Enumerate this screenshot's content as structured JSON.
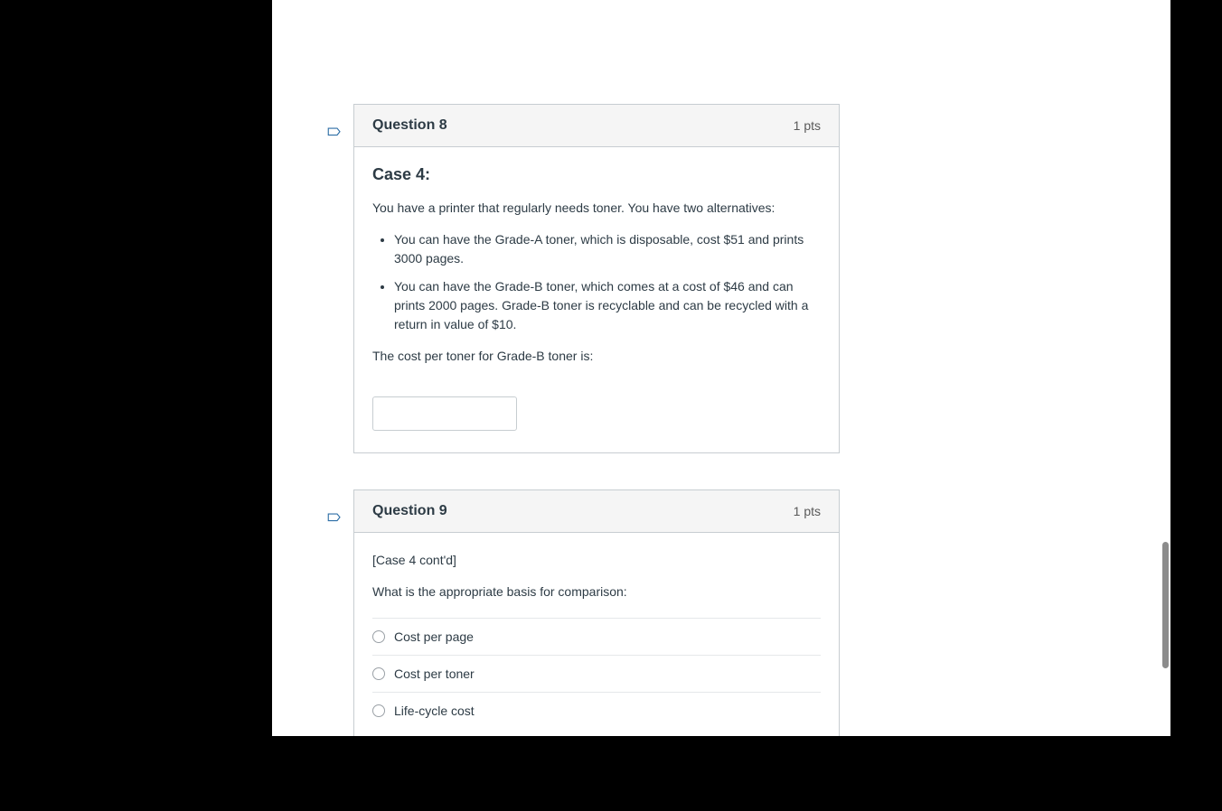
{
  "q8": {
    "title": "Question 8",
    "pts": "1 pts",
    "case_title": "Case 4:",
    "intro": "You have a printer that regularly needs toner. You have two alternatives:",
    "bullets": [
      "You can have the Grade-A toner, which is disposable, cost $51 and prints 3000 pages.",
      "You can have the Grade-B toner, which comes at a cost of $46 and can prints 2000 pages. Grade-B toner is recyclable and can be recycled with a return in value of $10."
    ],
    "prompt": "The cost per toner for Grade-B toner is:",
    "input_value": ""
  },
  "q9": {
    "title": "Question 9",
    "pts": "1 pts",
    "contd": "[Case 4 cont'd]",
    "prompt": "What is the appropriate basis for comparison:",
    "options": [
      "Cost per page",
      "Cost per toner",
      "Life-cycle cost"
    ]
  }
}
